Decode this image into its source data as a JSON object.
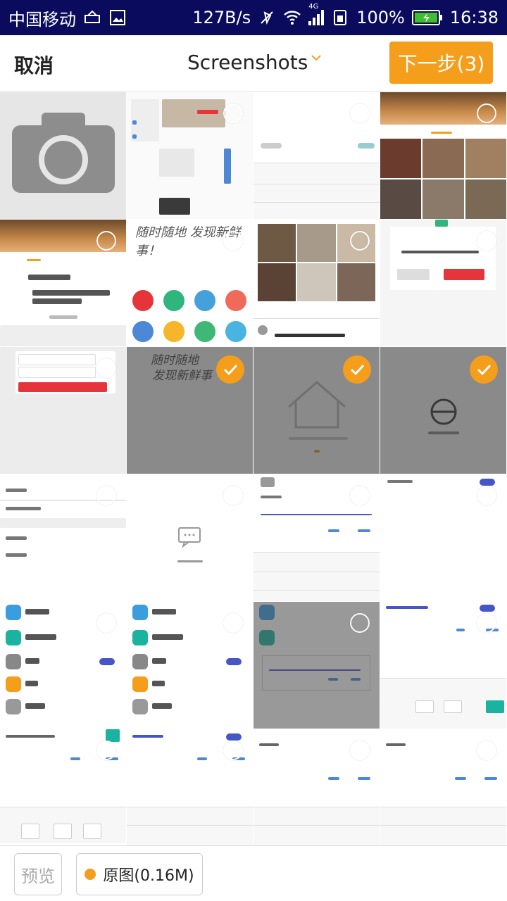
{
  "status_bar": {
    "carrier": "中国移动",
    "speed": "127B/s",
    "network": "4G",
    "battery": "100%",
    "time": "16:38"
  },
  "header": {
    "cancel_label": "取消",
    "album_name": "Screenshots",
    "next_label": "下一步(3)"
  },
  "grid": {
    "thumb_texts": {
      "handwriting": "随时随地 发现新鲜事！"
    }
  },
  "bottom_bar": {
    "preview_label": "预览",
    "original_label": "原图(0.16M)"
  },
  "colors": {
    "accent": "#f49e1c",
    "status_bar_bg": "#0b0b5e"
  }
}
